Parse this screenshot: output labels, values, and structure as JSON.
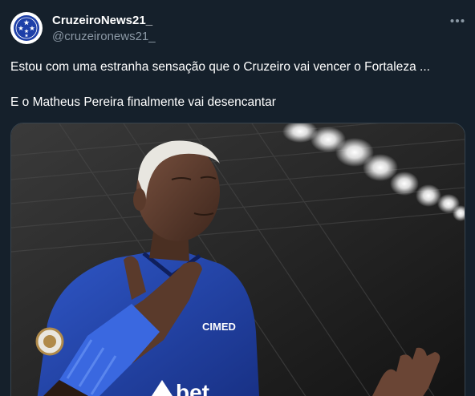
{
  "account": {
    "display_name": "CruzeiroNews21_",
    "handle": "@cruzeironews21_",
    "avatar_icon": "cruzeiro-crest-icon"
  },
  "more_icon": "more-horizontal-icon",
  "tweet": {
    "lines": [
      "Estou com uma estranha sensação que o Cruzeiro vai vencer o Fortaleza ...",
      "E o Matheus Pereira finalmente vai desencantar"
    ]
  },
  "media": {
    "jersey_text": "CIMED",
    "sponsor_text": "bet"
  },
  "colors": {
    "background": "#15202b",
    "text_primary": "#ffffff",
    "text_secondary": "#8b98a5",
    "border": "#38444d",
    "club_blue": "#1d3fa8"
  }
}
